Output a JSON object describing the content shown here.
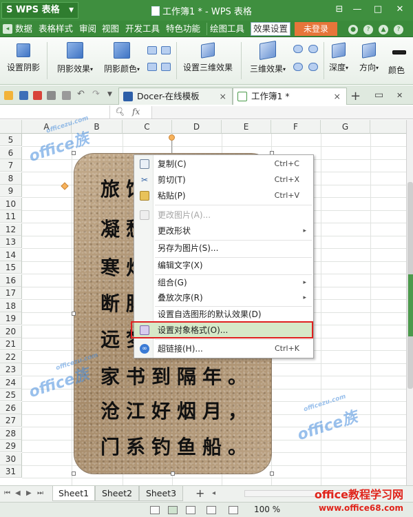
{
  "app": {
    "name": "WPS 表格",
    "window_title": "工作簿1 * - WPS 表格"
  },
  "menu": {
    "items": [
      "数据",
      "表格样式",
      "审阅",
      "视图",
      "开发工具",
      "特色功能",
      "绘图工具",
      "效果设置"
    ],
    "login": "未登录"
  },
  "ribbon": {
    "shadow_settings": "设置阴影",
    "shadow_effect": "阴影效果",
    "shadow_color": "阴影颜色",
    "three_d_settings": "设置三维效果",
    "three_d_effect": "三维效果",
    "depth": "深度",
    "direction": "方向",
    "color": "颜色"
  },
  "tabs": [
    {
      "label": "Docer-在线模板",
      "close": "×"
    },
    {
      "label": "工作簿1 *",
      "close": "×"
    }
  ],
  "formula": {
    "fx": "fx"
  },
  "columns": [
    "A",
    "B",
    "C",
    "D",
    "E",
    "F",
    "G"
  ],
  "rows": [
    "5",
    "6",
    "7",
    "8",
    "9",
    "10",
    "11",
    "12",
    "13",
    "14",
    "15",
    "16",
    "17",
    "18",
    "19",
    "20",
    "21",
    "22",
    "23",
    "24",
    "25",
    "26",
    "27",
    "28",
    "29",
    "30",
    "31"
  ],
  "poem": [
    "旅馆寒灯独不眠",
    "凝愁满目更萧然",
    "寒灯一曲思乡梦",
    "断肠人在天涯",
    "远梦寄春鸿",
    "家书到隔年。",
    "沧江好烟月，",
    "门系钓鱼船。"
  ],
  "context_menu": {
    "items": [
      {
        "label": "复制(C)",
        "shortcut": "Ctrl+C"
      },
      {
        "label": "剪切(T)",
        "shortcut": "Ctrl+X"
      },
      {
        "label": "粘贴(P)",
        "shortcut": "Ctrl+V"
      },
      {
        "label": "更改图片(A)..."
      },
      {
        "label": "更改形状"
      },
      {
        "label": "另存为图片(S)..."
      },
      {
        "label": "编辑文字(X)"
      },
      {
        "label": "组合(G)"
      },
      {
        "label": "叠放次序(R)"
      },
      {
        "label": "设置自选图形的默认效果(D)"
      },
      {
        "label": "设置对象格式(O)..."
      },
      {
        "label": "超链接(H)...",
        "shortcut": "Ctrl+K"
      }
    ]
  },
  "sheets": [
    "Sheet1",
    "Sheet2",
    "Sheet3"
  ],
  "status": {
    "zoom": "100 %"
  },
  "watermark": {
    "brand": "office教程学习网",
    "url": "www.office68.com",
    "logo": "office族",
    "logo_url": "officezu.com"
  },
  "colors": {
    "accent": "#3f8f3f",
    "login": "#e7753a",
    "highlight": "#d6e9c8",
    "red_box": "#e02020"
  }
}
